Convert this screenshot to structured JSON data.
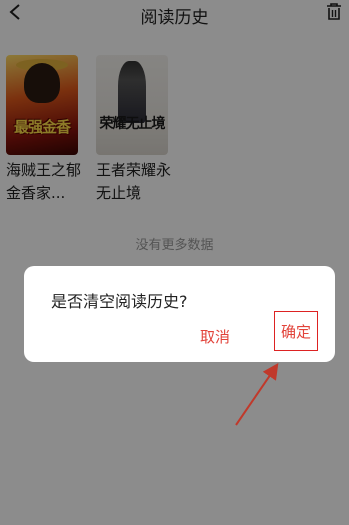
{
  "header": {
    "title": "阅读历史",
    "back_icon": "chevron-left-icon",
    "clear_icon": "trash-icon"
  },
  "history": [
    {
      "title": "海贼王之郁金香家...",
      "cover_text": "最强金香",
      "cover_accent": "#e05a1c"
    },
    {
      "title": "王者荣耀永无止境",
      "cover_text": "荣耀无止境",
      "cover_accent": "#1a1a1a"
    }
  ],
  "list_footer": "没有更多数据",
  "dialog": {
    "message": "是否清空阅读历史?",
    "cancel_label": "取消",
    "confirm_label": "确定",
    "button_color": "#e2433a"
  },
  "annotation": {
    "highlight_color": "#d22",
    "arrow_color": "#c0392b"
  }
}
